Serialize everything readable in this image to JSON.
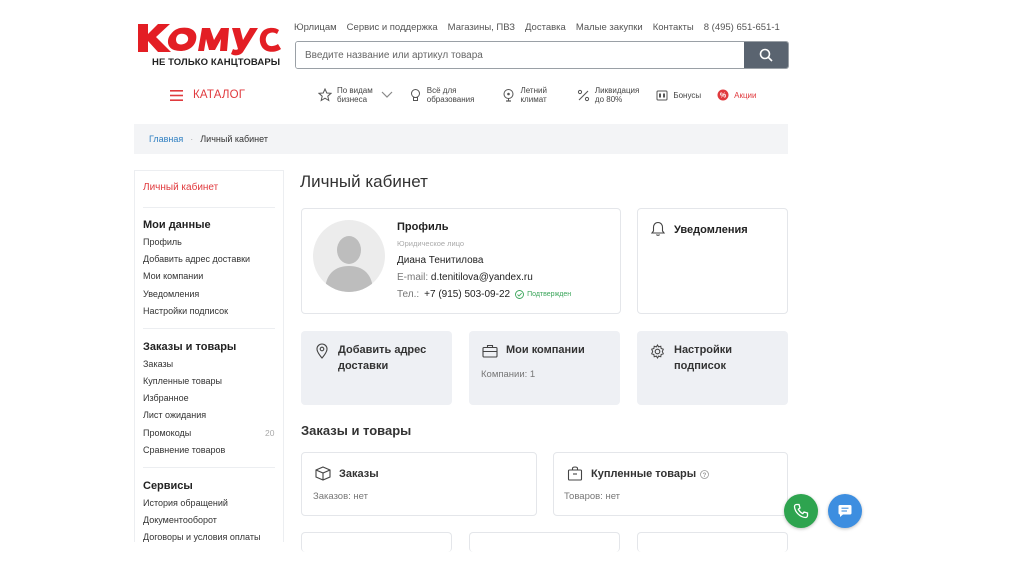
{
  "header": {
    "logo_text": "Комус",
    "logo_tagline": "НЕ ТОЛЬКО КАНЦТОВАРЫ",
    "top_links": [
      "Юрлицам",
      "Сервис и поддержка",
      "Магазины, ПВЗ",
      "Доставка",
      "Малые закупки",
      "Контакты",
      "8 (495) 651-651-1"
    ],
    "search_placeholder": "Введите название или артикул товара",
    "catalog_label": "КАТАЛОГ",
    "nav": [
      {
        "label1": "По видам",
        "label2": "бизнеса",
        "icon": "star-icon"
      },
      {
        "label1": "Всё для",
        "label2": "образования",
        "icon": "lightbulb-icon"
      },
      {
        "label1": "Летний",
        "label2": "климат",
        "icon": "fan-icon"
      },
      {
        "label1": "Ликвидация",
        "label2": "до 80%",
        "icon": "percent-icon"
      },
      {
        "label1": "Бонусы",
        "label2": "",
        "icon": "bonus-icon"
      },
      {
        "label1": "Акции",
        "label2": "",
        "icon": "sale-badge-icon"
      }
    ]
  },
  "breadcrumb": {
    "home": "Главная",
    "sep": "·",
    "current": "Личный кабинет"
  },
  "sidebar": {
    "active": "Личный кабинет",
    "my_data_title": "Мои данные",
    "my_data": [
      "Профиль",
      "Добавить адрес доставки",
      "Мои компании",
      "Уведомления",
      "Настройки подписок"
    ],
    "orders_title": "Заказы и товары",
    "orders": [
      "Заказы",
      "Купленные товары",
      "Избранное",
      "Лист ожидания",
      "Промокоды",
      "Сравнение товаров"
    ],
    "promo_count": "20",
    "services_title": "Сервисы",
    "services": [
      "История обращений",
      "Документооборот",
      "Договоры и условия оплаты"
    ]
  },
  "main": {
    "title": "Личный кабинет",
    "profile": {
      "title": "Профиль",
      "type": "Юридическое лицо",
      "name": "Диана Тенитилова",
      "email_label": "E-mail:",
      "email": "d.tenitilova@yandex.ru",
      "phone_label": "Тел.:",
      "phone": "+7 (915) 503-09-22",
      "verified": "Подтвержден"
    },
    "notifications_title": "Уведомления",
    "tiles": {
      "address_line1": "Добавить адрес",
      "address_line2": "доставки",
      "companies_title": "Мои компании",
      "companies_sub": "Компании: 1",
      "subs_line1": "Настройки",
      "subs_line2": "подписок"
    },
    "orders_section_title": "Заказы и товары",
    "orders_card": {
      "title": "Заказы",
      "sub": "Заказов: нет"
    },
    "bought_card": {
      "title": "Купленные товары",
      "sub": "Товаров: нет"
    }
  },
  "colors": {
    "brand_red": "#e03a3e",
    "link_blue": "#2f7fc1",
    "phone_fab": "#2ea44f",
    "chat_fab": "#3d8ee0",
    "verified_green": "#3aa55a"
  }
}
